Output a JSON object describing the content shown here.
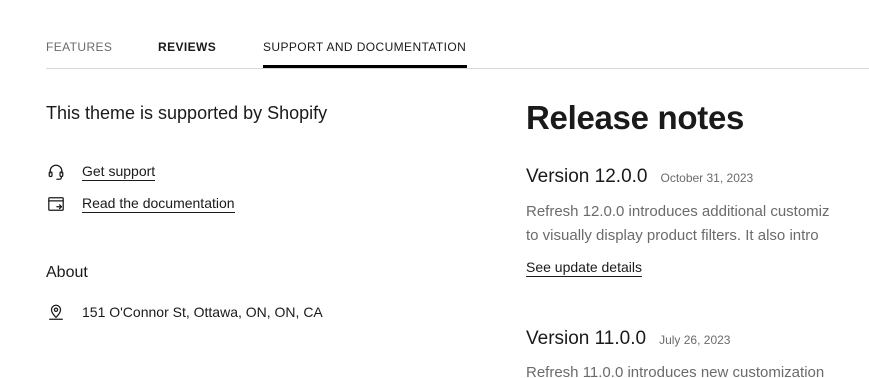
{
  "tabs": {
    "features": "FEATURES",
    "reviews": "REVIEWS",
    "support": "SUPPORT AND DOCUMENTATION"
  },
  "support": {
    "heading": "This theme is supported by Shopify",
    "links": [
      {
        "label": "Get support",
        "icon": "headset-icon"
      },
      {
        "label": "Read the documentation",
        "icon": "documentation-icon"
      }
    ]
  },
  "about": {
    "heading": "About",
    "address": "151 O'Connor St, Ottawa, ON, ON, CA",
    "icon": "location-pin-icon"
  },
  "release_notes": {
    "title": "Release notes",
    "versions": [
      {
        "version": "Version 12.0.0",
        "date": "October 31, 2023",
        "lines": [
          "Refresh 12.0.0 introduces additional customiz",
          "to visually display product filters. It also intro"
        ],
        "details_label": "See update details"
      },
      {
        "version": "Version 11.0.0",
        "date": "July 26, 2023",
        "lines": [
          "Refresh 11.0.0 introduces new customization"
        ]
      }
    ]
  }
}
